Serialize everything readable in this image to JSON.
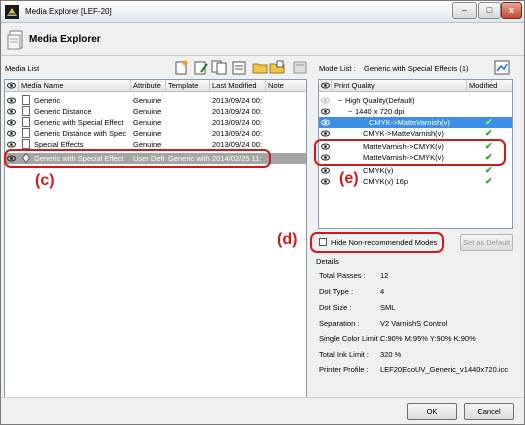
{
  "window": {
    "title": "Media Explorer [LEF-20]",
    "min": "–",
    "max": "□",
    "close": "x"
  },
  "header": {
    "title": "Media Explorer"
  },
  "media_list": {
    "label": "Media List",
    "columns": [
      "Media Name",
      "Attribute",
      "Template",
      "Last Modified",
      "Note"
    ],
    "rows": [
      {
        "name": "Generic",
        "attribute": "Genuine",
        "template": "",
        "modified": "2013/09/24 00:",
        "note": ""
      },
      {
        "name": "Generic Distance",
        "attribute": "Genuine",
        "template": "",
        "modified": "2013/09/24 00:",
        "note": ""
      },
      {
        "name": "Generic with Special Effect",
        "attribute": "Genuine",
        "template": "",
        "modified": "2013/09/24 00:",
        "note": ""
      },
      {
        "name": "Generic Distance with Spec",
        "attribute": "Genuine",
        "template": "",
        "modified": "2013/09/24 00:",
        "note": ""
      },
      {
        "name": "Special Effects",
        "attribute": "Genuine",
        "template": "",
        "modified": "2013/09/24 00:",
        "note": ""
      },
      {
        "name": "Generic with Special Effect",
        "attribute": "User Defi",
        "template": "Generic with",
        "modified": "2014/02/25 11:",
        "note": ""
      }
    ]
  },
  "mode_list": {
    "label": "Mode List :",
    "value": "Generic with Special Effects (1)",
    "columns": [
      "Print Quality",
      "Modified"
    ],
    "tree": {
      "group": "High Quality(Default)",
      "resolution": "1440 x 720 dpi",
      "modes": [
        {
          "label": "CMYK->MatteVarnish(v)",
          "modified": "✔",
          "selected": true
        },
        {
          "label": "CMYK->MatteVarnish(v)",
          "modified": "✔",
          "selected": false
        },
        {
          "label": "MatteVarnish->CMYK(v)",
          "modified": "✔",
          "selected": false
        },
        {
          "label": "MatteVarnish->CMYK(v)",
          "modified": "✔",
          "selected": false
        },
        {
          "label": "CMYK(v)",
          "modified": "✔",
          "selected": false
        },
        {
          "label": "CMYK(v) 16p",
          "modified": "✔",
          "selected": false
        }
      ]
    }
  },
  "callouts": {
    "c": "(c)",
    "d": "(d)",
    "e": "(e)"
  },
  "hide_checkbox": {
    "label": "Hide Non-recommended Modes",
    "checked": false
  },
  "set_default": "Set as Default",
  "details": {
    "title": "Details",
    "items": [
      {
        "key": "Total Passes :",
        "value": "12"
      },
      {
        "key": "Dot Type :",
        "value": "4"
      },
      {
        "key": "Dot Size :",
        "value": "SML"
      },
      {
        "key": "Separation :",
        "value": "V2 VarnishS Control"
      },
      {
        "key": "Single Color Limit :",
        "value": "C:90%  M:95%  Y:90%  K:90%"
      },
      {
        "key": "Total Ink Limit :",
        "value": "320 %"
      },
      {
        "key": "Printer Profile :",
        "value": "LEF20EcoUV_Generic_v1440x720.icc"
      }
    ]
  },
  "buttons": {
    "ok": "OK",
    "cancel": "Cancel"
  },
  "colors": {
    "annotation": "#d21919",
    "selection": "#3d8ee6",
    "check": "#2ea33b"
  }
}
